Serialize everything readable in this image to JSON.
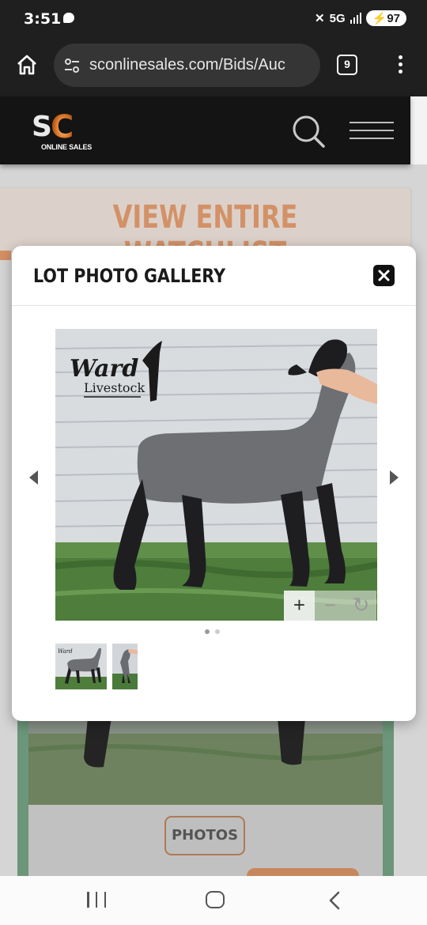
{
  "status_bar": {
    "time": "3:51",
    "network": "5G",
    "battery": "97"
  },
  "browser": {
    "url": "sconlinesales.com/Bids/Auc",
    "tab_count": "9"
  },
  "site_header": {
    "logo_text": "SC",
    "logo_subtext": "ONLINE SALES"
  },
  "page": {
    "watchlist_link": "VIEW ENTIRE WATCHLIST",
    "photos_button": "PHOTOS"
  },
  "modal": {
    "title": "LOT PHOTO GALLERY",
    "photo_logo_line1": "Ward",
    "photo_logo_line2": "Livestock",
    "zoom_in": "+",
    "zoom_out": "−",
    "reset": "↻",
    "slide_count": 2,
    "active_slide": 1
  },
  "colors": {
    "accent_orange": "#f1a676",
    "header_bg": "#141414",
    "green_border": "#7bab8a"
  },
  "icons": [
    "home-icon",
    "tune-icon",
    "kebab-icon",
    "search-icon",
    "hamburger-icon",
    "close-icon",
    "chevron-left-icon",
    "chevron-right-icon",
    "recents-icon",
    "back-icon"
  ]
}
